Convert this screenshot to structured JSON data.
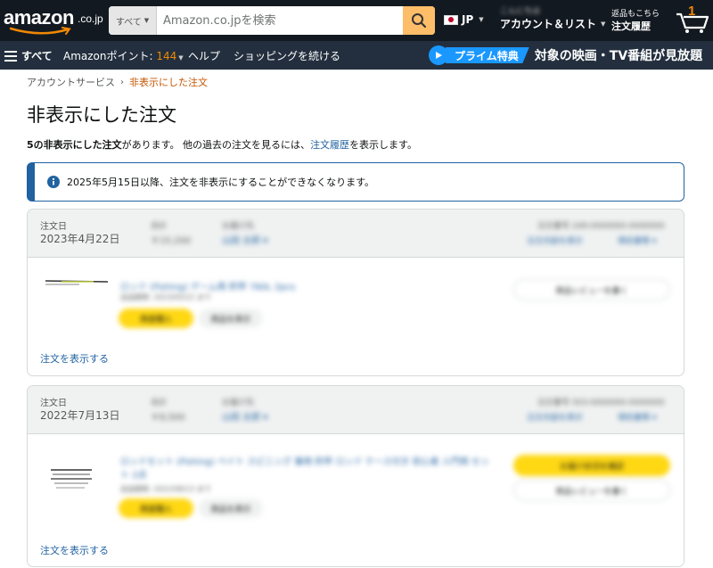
{
  "header": {
    "logo_text": "amazon",
    "logo_suffix": ".co.jp",
    "search": {
      "category": "すべて",
      "placeholder": "Amazon.co.jpを検索"
    },
    "language": "JP",
    "account": {
      "greeting": "こんにちは",
      "label": "アカウント＆リスト"
    },
    "orders": {
      "line1": "返品もこちら",
      "line2": "注文履歴"
    },
    "cart_count": "1"
  },
  "subnav": {
    "all_label": "すべて",
    "points_label": "Amazonポイント: ",
    "points_value": "144",
    "help_label": "ヘルプ",
    "continue_label": "ショッピングを続ける",
    "prime_badge": "プライム特典",
    "prime_text": "対象の映画・TV番組が見放題"
  },
  "breadcrumb": {
    "parent": "アカウントサービス",
    "separator": "›",
    "current": "非表示にした注文"
  },
  "page": {
    "title": "非表示にした注文",
    "summary_bold": "5の非表示にした注文",
    "summary_mid": "があります。 他の過去の注文を見るには、",
    "summary_link": "注文履歴",
    "summary_end": "を表示します。",
    "notice": "2025年5月15日以降、注文を非表示にすることができなくなります。"
  },
  "orders": [
    {
      "date_label": "注文日",
      "date_value": "2023年4月22日",
      "view_order": "注文を表示する"
    },
    {
      "date_label": "注文日",
      "date_value": "2022年7月13日",
      "view_order": "注文を表示する"
    }
  ],
  "colors": {
    "nav_bg": "#131921",
    "subnav_bg": "#232f3e",
    "accent_orange": "#f08804",
    "search_button": "#febd69",
    "link": "#2162a1",
    "prime_blue": "#1a98ff",
    "button_yellow": "#ffd814"
  }
}
